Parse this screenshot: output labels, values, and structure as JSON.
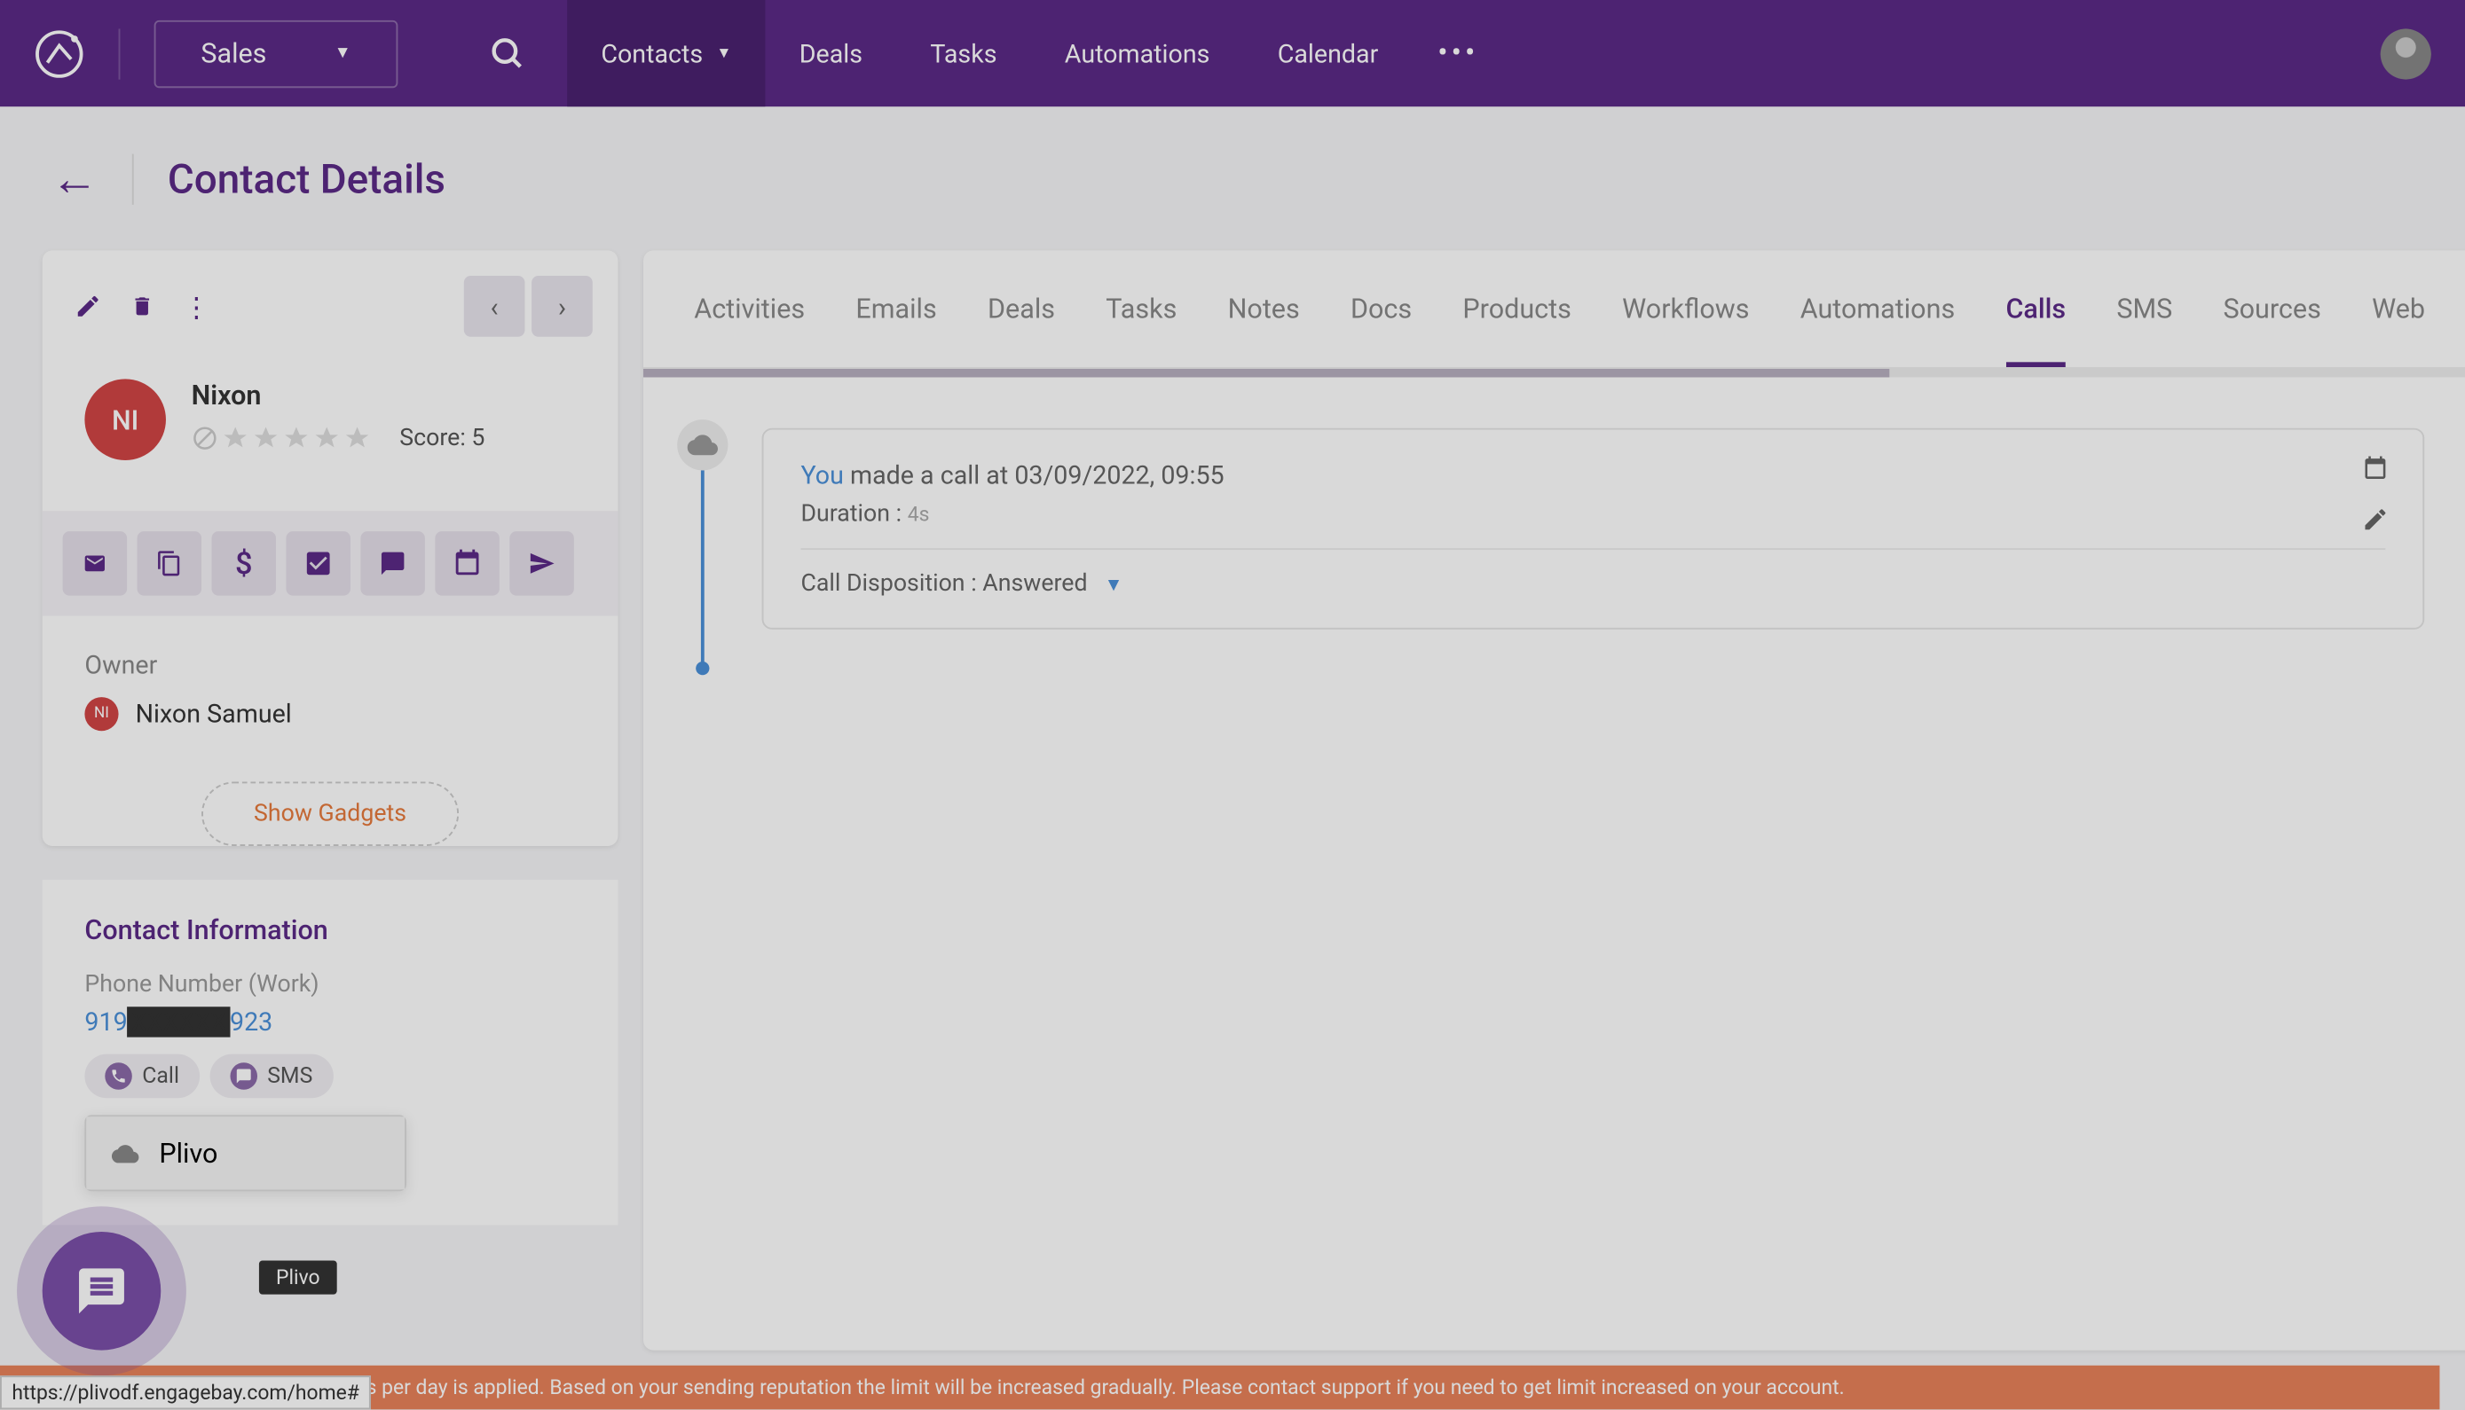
{
  "topbar": {
    "module": "Sales",
    "nav": [
      "Contacts",
      "Deals",
      "Tasks",
      "Automations",
      "Calendar"
    ],
    "active_nav": 0
  },
  "page": {
    "title": "Contact Details"
  },
  "contact": {
    "initials": "NI",
    "name": "Nixon",
    "score_label": "Score: 5"
  },
  "owner": {
    "label": "Owner",
    "initials": "NI",
    "name": "Nixon Samuel"
  },
  "gadgets_btn": "Show Gadgets",
  "contact_info": {
    "title": "Contact Information",
    "phone_label": "Phone Number (Work)",
    "phone_prefix": "919",
    "phone_suffix": "923",
    "call_chip": "Call",
    "sms_chip": "SMS",
    "dropdown_item": "Plivo",
    "tooltip": "Plivo"
  },
  "tabs": [
    "Activities",
    "Emails",
    "Deals",
    "Tasks",
    "Notes",
    "Docs",
    "Products",
    "Workflows",
    "Automations",
    "Calls",
    "SMS",
    "Sources",
    "Web"
  ],
  "active_tab": 9,
  "call_entry": {
    "actor": "You",
    "text": " made a call at 03/09/2022, 09:55",
    "duration_label": "Duration : ",
    "duration_value": "4s",
    "disposition": "Call Disposition : Answered"
  },
  "warning": "tly warming up and a limit of 100 emails per day is applied. Based on your sending reputation the limit will be increased gradually. Please contact support if you need to get limit increased on your account.",
  "url": "https://plivodf.engagebay.com/home#"
}
